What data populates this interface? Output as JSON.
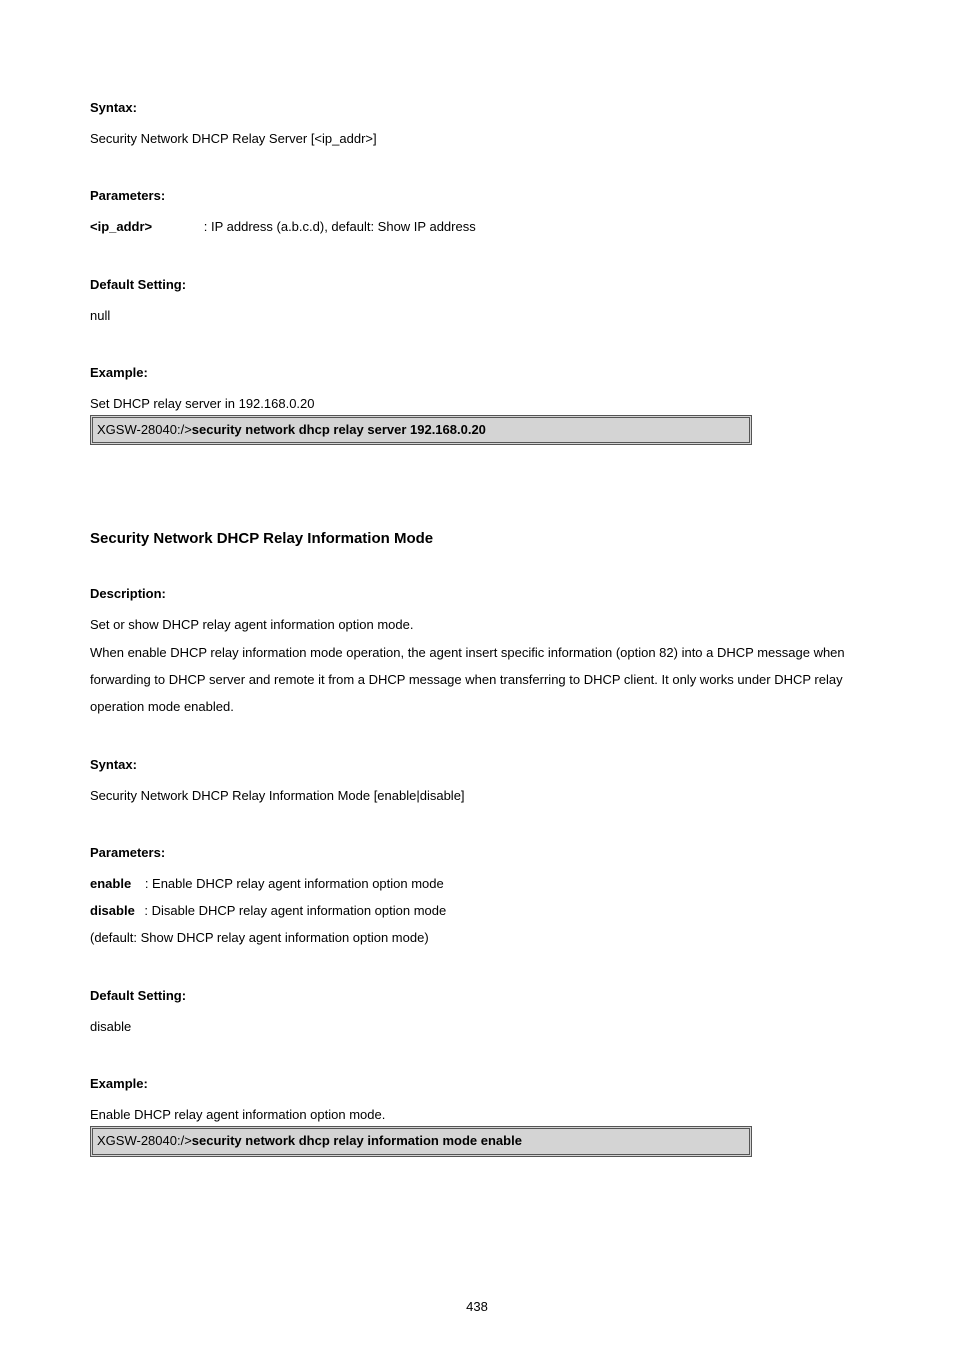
{
  "sec1": {
    "syntax_heading": "Syntax:",
    "syntax_body": "Security Network DHCP Relay Server [<ip_addr>]",
    "params_heading": "Parameters:",
    "params_label": "<ip_addr>",
    "params_text": ": IP address (a.b.c.d), default: Show IP address",
    "default_heading": "Default Setting:",
    "default_value": "null",
    "example_heading": "Example:",
    "example_text": "Set DHCP relay server in 192.168.0.20",
    "code_prompt": "XGSW-28040:/>",
    "code_cmd": "security network dhcp relay server 192.168.0.20"
  },
  "sec2": {
    "title": "Security Network DHCP Relay Information Mode",
    "desc_heading": "Description:",
    "desc_line1": "Set or show DHCP relay agent information option mode.",
    "desc_line2": "When enable DHCP relay information mode operation, the agent insert specific information (option 82) into a DHCP message when forwarding to DHCP server and remote it from a DHCP message when transferring to DHCP client. It only works under DHCP relay operation mode enabled.",
    "syntax_heading": "Syntax:",
    "syntax_body": "Security Network DHCP Relay Information Mode [enable|disable]",
    "params_heading": "Parameters:",
    "param_enable_label": "enable",
    "param_enable_text": ": Enable DHCP relay agent information option mode",
    "param_disable_label": "disable",
    "param_disable_text": ": Disable DHCP relay agent information option mode",
    "param_default_note": "(default: Show DHCP relay agent information option mode)",
    "default_heading": "Default Setting:",
    "default_value": "disable",
    "example_heading": "Example:",
    "example_text": "Enable DHCP relay agent information option mode.",
    "code_prompt": "XGSW-28040:/>",
    "code_cmd": "security network dhcp relay information mode enable"
  },
  "page_number": "438"
}
